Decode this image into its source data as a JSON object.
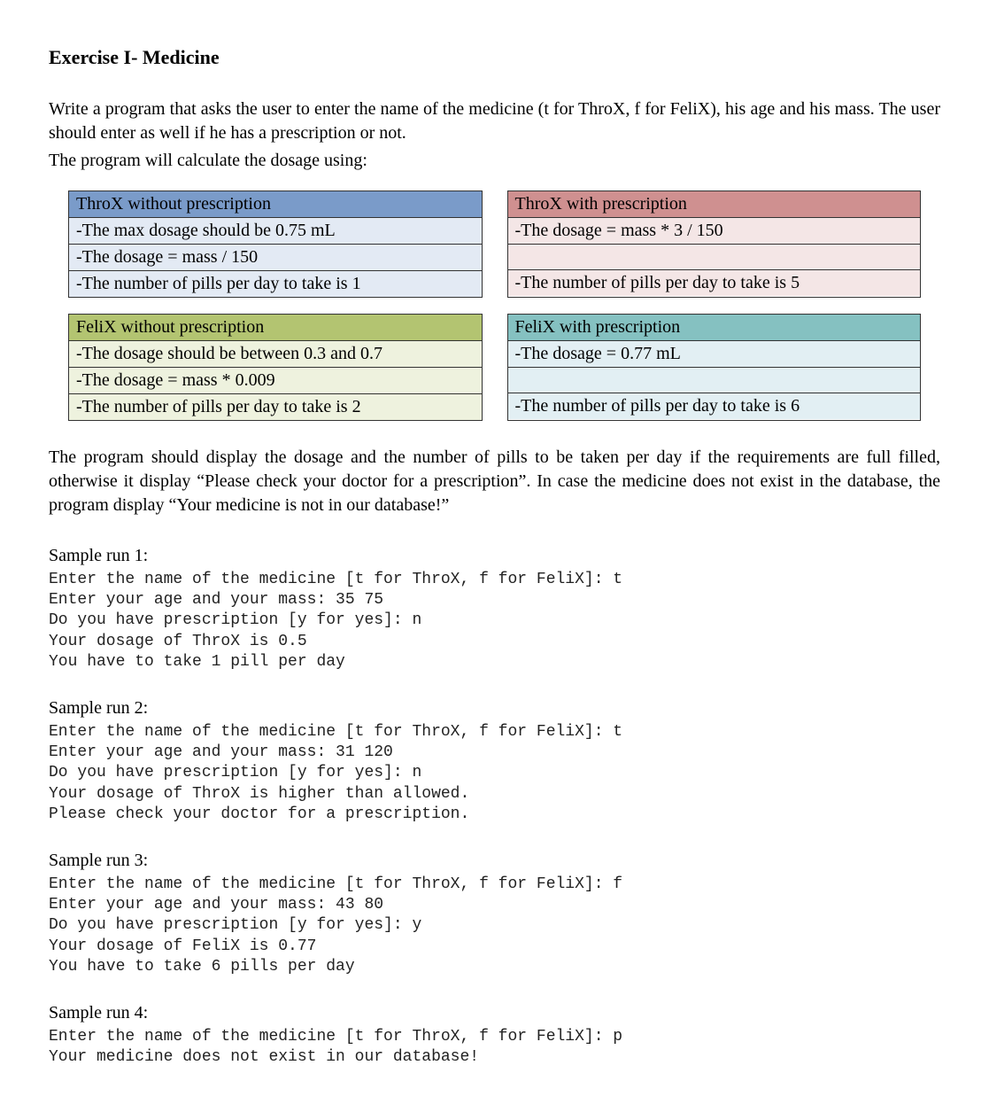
{
  "title": "Exercise I- Medicine",
  "intro": {
    "p1": "Write a program that asks the user to enter the name of the medicine (t for ThroX, f for FeliX), his age and his mass. The user should enter as well if he has a prescription or not.",
    "p2": "The program will calculate the dosage using:"
  },
  "boxes": {
    "throx_no": {
      "header": "ThroX without prescription",
      "rows": [
        "-The max dosage should be 0.75 mL",
        "-The dosage = mass / 150",
        "-The number of pills per day to take is 1"
      ]
    },
    "throx_yes": {
      "header": "ThroX with prescription",
      "rows": [
        "-The dosage = mass * 3 / 150",
        "-The number of pills per day to take is 5"
      ]
    },
    "felix_no": {
      "header": "FeliX without prescription",
      "rows": [
        "-The dosage should be between 0.3 and 0.7",
        "-The dosage = mass * 0.009",
        "-The number of pills per day to take is 2"
      ]
    },
    "felix_yes": {
      "header": "FeliX with prescription",
      "rows": [
        "-The dosage = 0.77 mL",
        "-The number of pills per day to take is 6"
      ]
    }
  },
  "after": "The program should display the dosage and the number of pills to be taken per day if the requirements are full filled, otherwise it display “Please check your doctor for a prescription”. In case the medicine does not exist in the database, the program display “Your medicine is not in our database!”",
  "samples": {
    "s1": {
      "title": "Sample run 1:",
      "text": "Enter the name of the medicine [t for ThroX, f for FeliX]: t\nEnter your age and your mass: 35 75\nDo you have prescription [y for yes]: n\nYour dosage of ThroX is 0.5\nYou have to take 1 pill per day"
    },
    "s2": {
      "title": "Sample run 2:",
      "text": "Enter the name of the medicine [t for ThroX, f for FeliX]: t\nEnter your age and your mass: 31 120\nDo you have prescription [y for yes]: n\nYour dosage of ThroX is higher than allowed.\nPlease check your doctor for a prescription."
    },
    "s3": {
      "title": "Sample run 3:",
      "text": "Enter the name of the medicine [t for ThroX, f for FeliX]: f\nEnter your age and your mass: 43 80\nDo you have prescription [y for yes]: y\nYour dosage of FeliX is 0.77\nYou have to take 6 pills per day"
    },
    "s4": {
      "title": "Sample run 4:",
      "text": "Enter the name of the medicine [t for ThroX, f for FeliX]: p\nYour medicine does not exist in our database!"
    }
  }
}
